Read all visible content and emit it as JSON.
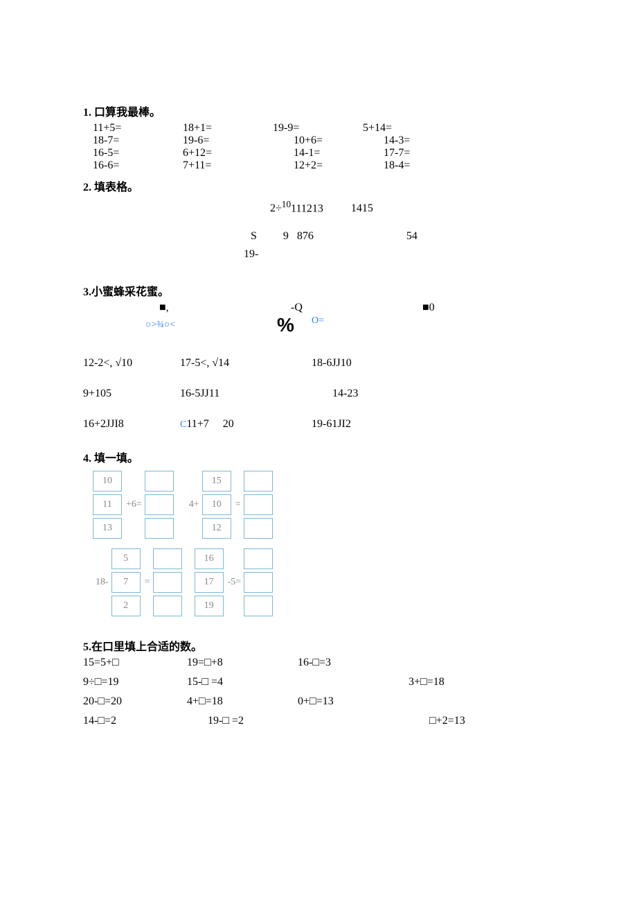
{
  "q1": {
    "heading": "1. 口算我最棒。",
    "rows": [
      [
        "11+5=",
        "18+1=",
        "19-9=",
        "5+14="
      ],
      [
        "18-7=",
        "19-6=",
        "10+6=",
        "14-3="
      ],
      [
        "16-5=",
        "6+12=",
        "14-1=",
        "17-7="
      ],
      [
        "16-6=",
        "7+11=",
        "12+2=",
        "18-4="
      ]
    ]
  },
  "q2": {
    "heading": "2. 填表格。",
    "line1a": "2÷",
    "line1b": "10",
    "line1c": "111213",
    "line1d": "1415",
    "line2a": "S",
    "line2b": "9   876",
    "line2c": "54",
    "line3": "19-"
  },
  "q3": {
    "heading": "3.小蜜蜂采花蜜。",
    "bee_a": "■,",
    "bee_b": "-Q",
    "bee_c": "■0",
    "sym_left": "○>¾○<",
    "sym_mid": "%",
    "sym_right": "O=",
    "rows": [
      [
        "12-2<, √10",
        "17-5<, √14",
        "18-6JJ10"
      ],
      [
        "9+105",
        "16-5JJ11",
        "14-23"
      ],
      [
        "16+2JJI8",
        "C11+7     20",
        "19-61JI2"
      ]
    ],
    "c_prefix": "C"
  },
  "q4": {
    "heading": "4. 填一填。",
    "b1": {
      "left": [
        "10",
        "11",
        "13"
      ],
      "op": "+6="
    },
    "b2": {
      "left": [
        "15",
        "10",
        "12"
      ],
      "op_pre": "4+",
      "op_post": "="
    },
    "b3": {
      "left_num": "18-",
      "mid": [
        "5",
        "7",
        "2"
      ],
      "op": "="
    },
    "b4": {
      "left": [
        "16",
        "17",
        "19"
      ],
      "op": "-5="
    }
  },
  "q5": {
    "heading": "5.在口里填上合适的数。",
    "rows": [
      [
        "15=5+□",
        "19=□+8",
        "16-□=3",
        ""
      ],
      [
        "9÷□=19",
        "15-□  =4",
        "",
        "3+□=18"
      ],
      [
        "20-□=20",
        "4+□=18",
        "0+□=13",
        ""
      ],
      [
        "14-□=2",
        "19-□  =2",
        "",
        "□+2=13"
      ]
    ]
  }
}
